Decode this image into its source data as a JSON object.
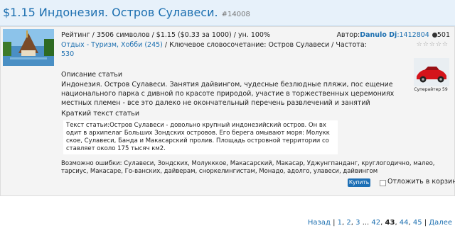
{
  "header": {
    "title": "$1.15 Индонезия. Остров Сулавеси.",
    "id": "#14008"
  },
  "meta": {
    "rating": "Рейтинг / 3506 символов / $1.15 ($0.33 за 1000) / ун. 100%",
    "category": "Отдых - Туризм, Хобби",
    "category_count": "(245)",
    "keyword": "/ Ключевое словосочетание: Остров Сулавеси / Частота:",
    "frequency": "530"
  },
  "author": {
    "label": "Автор:",
    "name": "Danulo Dj",
    "id": ":1412804",
    "score": "501",
    "stars": "☆☆☆☆☆",
    "caption": "Суперайтер 59"
  },
  "description": {
    "heading": "Описание статьи",
    "text": "  Индонезия. Остров Сулавеси. Занятия дайвингом, чудесные безлюдные пляжи, пос ещение национального парка с дивной по красоте природой, участие в торжественных церемониях местных племен - все это далеко не окончательный перечень развлечений и занятий"
  },
  "short": {
    "heading": "Краткий текст статьи",
    "text": "Текст статьи:Остров Сулавеси - довольно крупный индонезийский остров. Он вх одит в архипелаг Больших Зондских островов. Его берега омывают моря: Молукк ское, Сулавеси, Банда и Макасарский пролив. Площадь островной территории со ставляет около 175 тысяч км2."
  },
  "errors": "Возможно ошибки: Сулавеси, Зондских, Молукккое, Макасарский, Макасар, Уджунгпанданг, круглогодично, малео, тарсиус, Макасаре, Го-ванских, дайверам, снорк­елингистам, Монадо, адолго, улавеси, дайвингом",
  "actions": {
    "buy": "Купить",
    "cart": "Отложить в корзину"
  },
  "pager": {
    "back": "Назад",
    "pages_before": [
      "1",
      "2",
      "3"
    ],
    "ellipsis": "...",
    "pages_mid": [
      "42"
    ],
    "current": "43",
    "pages_after": [
      "44",
      "45"
    ],
    "forward": "Далее"
  },
  "colors": {
    "link": "#1c6fb0",
    "header_bg": "#e7f1fa",
    "button": "#1d6fb5"
  }
}
